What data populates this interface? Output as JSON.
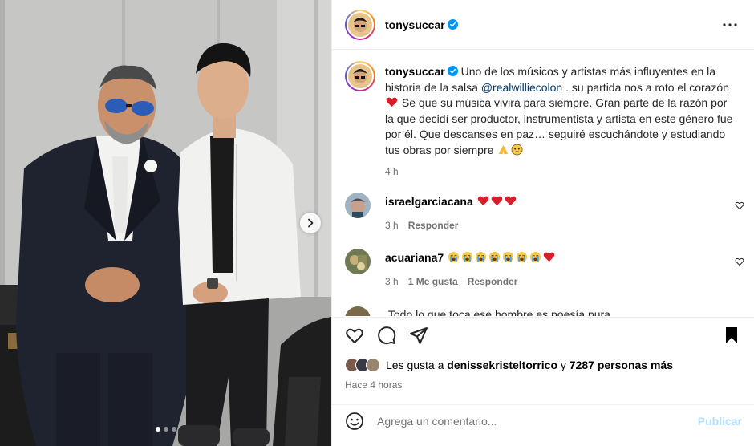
{
  "post": {
    "author": "tonysuccar",
    "carousel_total": 3,
    "carousel_current": 1
  },
  "caption": {
    "user": "tonysuccar",
    "text_before_mention": " Uno de los músicos y artistas más influyentes en la historia de la salsa ",
    "mention": "@realwilliecolon",
    "text_after_mention": " . su partida nos a roto el corazón ",
    "text_after_heart": " Se que su música vivirá para siempre. Gran parte de la razón por la que decidí ser productor, instrumentista y artista en este género fue por él. Que descanses en paz… seguiré escuchándote y estudiando tus obras por siempre ",
    "time": "4 h"
  },
  "comments": [
    {
      "user": "israelgarciacana",
      "emoji": [
        "heart",
        "heart",
        "heart"
      ],
      "time": "3 h",
      "reply_label": "Responder"
    },
    {
      "user": "acuariana7",
      "emoji": [
        "crying",
        "crying",
        "crying",
        "crying",
        "crying",
        "crying",
        "crying",
        "heart"
      ],
      "time": "3 h",
      "likes_label": "1 Me gusta",
      "reply_label": "Responder"
    }
  ],
  "partial_comment": {
    "text": "Todo lo que toca ese hombre es poesía pura"
  },
  "likes": {
    "prefix": "Les gusta a ",
    "user": "denissekristeltorrico",
    "middle": " y ",
    "count": "7287 personas más"
  },
  "timestamp": "Hace 4 horas",
  "composer": {
    "placeholder": "Agrega un comentario...",
    "post_label": "Publicar"
  },
  "colors": {
    "accent": "#0095f6",
    "post_disabled": "#b2dffc",
    "heart": "#ed4956",
    "mention": "#00376b",
    "secondary_text": "#737373"
  }
}
